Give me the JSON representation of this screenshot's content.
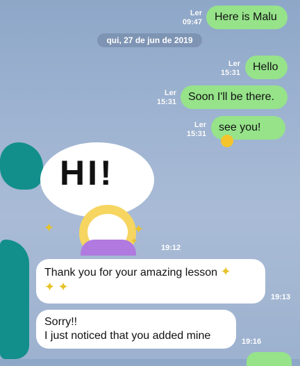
{
  "messages": {
    "m1": {
      "text": "Here is Malu",
      "read": "Ler",
      "time": "09:47"
    },
    "date": "qui, 27 de jun de 2019",
    "m2": {
      "text": "Hello",
      "read": "Ler",
      "time": "15:31"
    },
    "m3": {
      "text": "Soon I'll be there.",
      "read": "Ler",
      "time": "15:31"
    },
    "m4": {
      "text": "see you!",
      "read": "Ler",
      "time": "15:31"
    },
    "sticker": {
      "text": "HI!",
      "time": "19:12"
    },
    "m5": {
      "text": "Thank you for your amazing lesson",
      "time": "19:13"
    },
    "m6": {
      "line1": "Sorry!!",
      "line2": "I just noticed that you added  mine",
      "time": "19:16"
    }
  },
  "colors": {
    "outgoing": "#96e38a",
    "incoming": "#ffffff",
    "accent": "#138f8b"
  }
}
